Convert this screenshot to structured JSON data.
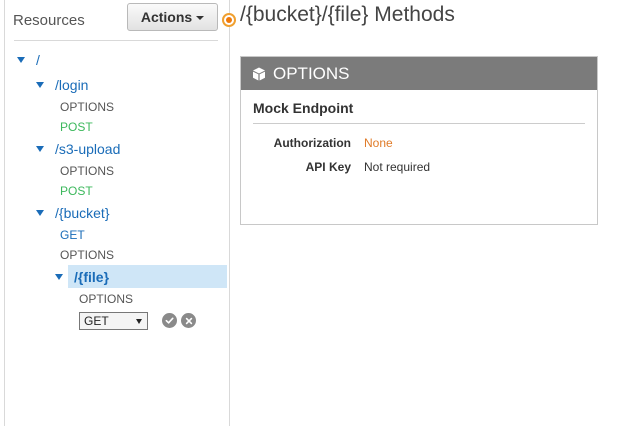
{
  "sidebar": {
    "title": "Resources",
    "actions_label": "Actions"
  },
  "tree": {
    "root": "/",
    "login": {
      "path": "/login",
      "methods": [
        "OPTIONS",
        "POST"
      ]
    },
    "s3_upload": {
      "path": "/s3-upload",
      "methods": [
        "OPTIONS",
        "POST"
      ]
    },
    "bucket": {
      "path": "/{bucket}",
      "methods": [
        "GET",
        "OPTIONS"
      ]
    },
    "file": {
      "path": "/{file}",
      "methods": [
        "OPTIONS"
      ]
    },
    "new_method_select": "GET"
  },
  "main": {
    "title": "/{bucket}/{file} Methods",
    "panel": {
      "header": "OPTIONS",
      "subtitle": "Mock Endpoint",
      "rows": [
        {
          "label": "Authorization",
          "value": "None"
        },
        {
          "label": "API Key",
          "value": "Not required"
        }
      ]
    }
  },
  "colors": {
    "link": "#1a6cb8",
    "post": "#3cb85c",
    "highlight": "#cfe6f7",
    "panel_header": "#7b7b7b",
    "none_value": "#e07b28"
  },
  "icons": {
    "panel_header": "cube-icon",
    "confirm": "checkmark-icon",
    "cancel": "close-icon"
  }
}
